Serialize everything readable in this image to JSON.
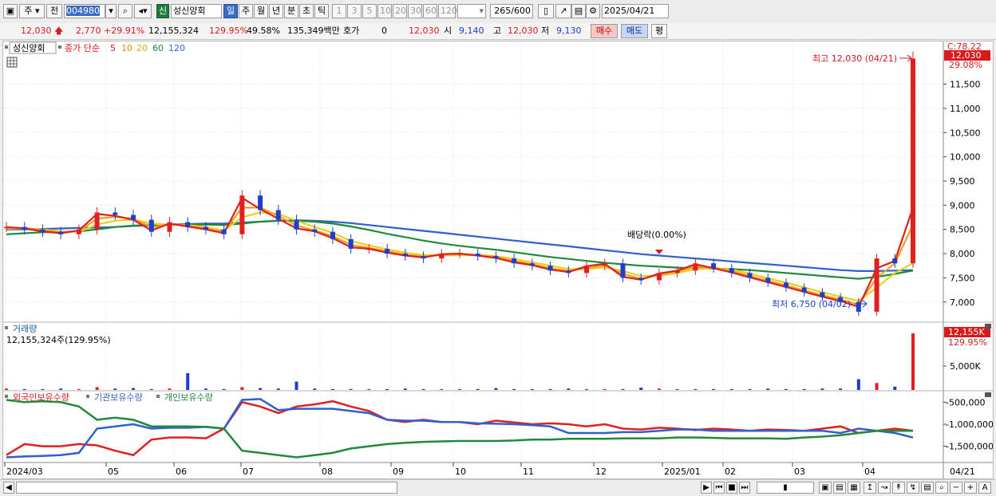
{
  "toolbar": {
    "mode_a": "주",
    "mode_b": "전",
    "code": "004980",
    "shin_badge": "신",
    "stock_name": "성신양회",
    "periods": [
      "일",
      "주",
      "월",
      "년",
      "분",
      "초",
      "틱"
    ],
    "intervals": [
      "1",
      "3",
      "5",
      "10",
      "20",
      "30",
      "60",
      "120"
    ],
    "count": "265",
    "count_max": "/600",
    "date": "2025/04/21"
  },
  "info": {
    "price": "12,030",
    "change": "2,770",
    "change_pct": "+29.91%",
    "volume": "12,155,324",
    "vol_ratio": "129.95%",
    "turnover": "49.58%",
    "amount": "135,349백만",
    "hoga_label": "호가",
    "hoga_value": "0",
    "cur_price": "12,030",
    "open_label": "시",
    "open_value": "9,140",
    "high_label": "고",
    "high_value": "12,030",
    "low_label": "저",
    "low_value": "9,130",
    "buy_label": "매수",
    "sell_label": "매도",
    "avg_label": "평"
  },
  "legend": {
    "name": "성신양회",
    "ma_label": "종가 단순",
    "ma": [
      {
        "label": "5",
        "color": "#e02020"
      },
      {
        "label": "10",
        "color": "#f0a020"
      },
      {
        "label": "20",
        "color": "#e6d020"
      },
      {
        "label": "60",
        "color": "#1e8a3a"
      },
      {
        "label": "120",
        "color": "#2f5fd0"
      }
    ],
    "volume_title": "거래량",
    "volume_value": "12,155,324주(129.95%)",
    "holdings": [
      {
        "label": "외국인보유수량",
        "color": "#e02020"
      },
      {
        "label": "기관보유수량",
        "color": "#2f5fd0"
      },
      {
        "label": "개인보유수량",
        "color": "#1e8a3a"
      }
    ]
  },
  "annotations": {
    "high": "최고 12,030 (04/21)",
    "low": "최저 6,750 (04/02)",
    "dividend": "배당락(0.00%)"
  },
  "right_axis": {
    "top_label": "C:78.22",
    "price_tag": "12,030",
    "price_pct": "29.08%",
    "vol_tag": "12,155K",
    "vol_pct": "129.95%",
    "vol_tick": "5,000K"
  },
  "chart_data": {
    "type": "candlestick",
    "x_labels": [
      "2024/03",
      "05",
      "06",
      "07",
      "08",
      "09",
      "10",
      "11",
      "12",
      "2025/01",
      "02",
      "03",
      "04"
    ],
    "last_x_label": "04/21",
    "price_ticks": [
      7000,
      7500,
      8000,
      8500,
      9000,
      9500,
      10000,
      10500,
      11000,
      11500
    ],
    "price_range": [
      6650,
      12300
    ],
    "price_series": [
      {
        "name": "종가",
        "values": [
          8550,
          8500,
          8450,
          8400,
          8500,
          8850,
          8800,
          8700,
          8450,
          8650,
          8550,
          8500,
          8400,
          9200,
          8900,
          8700,
          8500,
          8450,
          8300,
          8100,
          8100,
          8000,
          7950,
          7900,
          8000,
          8000,
          7950,
          7900,
          7800,
          7750,
          7650,
          7600,
          7750,
          7800,
          7500,
          7450,
          7600,
          7650,
          7800,
          7700,
          7600,
          7500,
          7400,
          7300,
          7200,
          7100,
          7000,
          6800,
          7900,
          7800,
          12030
        ]
      },
      {
        "name": "5",
        "color": "#e02020",
        "values": [
          8550,
          8520,
          8460,
          8420,
          8480,
          8820,
          8780,
          8700,
          8480,
          8620,
          8560,
          8500,
          8420,
          9150,
          8920,
          8720,
          8520,
          8460,
          8320,
          8130,
          8100,
          8020,
          7960,
          7920,
          7990,
          8000,
          7960,
          7910,
          7820,
          7760,
          7670,
          7620,
          7740,
          7790,
          7520,
          7460,
          7590,
          7650,
          7780,
          7700,
          7610,
          7510,
          7410,
          7310,
          7210,
          7110,
          7020,
          6900,
          7700,
          7850,
          8950
        ]
      },
      {
        "name": "10",
        "color": "#f0a020",
        "values": [
          8540,
          8530,
          8480,
          8440,
          8460,
          8720,
          8760,
          8720,
          8550,
          8600,
          8580,
          8520,
          8450,
          8950,
          8950,
          8780,
          8580,
          8480,
          8360,
          8180,
          8120,
          8050,
          7980,
          7940,
          7970,
          7990,
          7970,
          7930,
          7850,
          7780,
          7700,
          7640,
          7700,
          7760,
          7580,
          7480,
          7560,
          7630,
          7730,
          7710,
          7640,
          7540,
          7440,
          7340,
          7240,
          7140,
          7050,
          6950,
          7500,
          7800,
          8600
        ]
      },
      {
        "name": "20",
        "color": "#e6d020",
        "values": [
          8520,
          8520,
          8500,
          8460,
          8450,
          8600,
          8680,
          8700,
          8620,
          8600,
          8590,
          8550,
          8480,
          8750,
          8850,
          8820,
          8680,
          8550,
          8430,
          8260,
          8170,
          8090,
          8020,
          7970,
          7960,
          7970,
          7970,
          7950,
          7890,
          7820,
          7750,
          7680,
          7680,
          7720,
          7640,
          7540,
          7540,
          7600,
          7680,
          7700,
          7670,
          7590,
          7490,
          7400,
          7300,
          7200,
          7110,
          7020,
          7300,
          7600,
          7800
        ]
      },
      {
        "name": "60",
        "color": "#1e8a3a",
        "values": [
          8400,
          8420,
          8440,
          8450,
          8460,
          8500,
          8550,
          8580,
          8590,
          8600,
          8600,
          8600,
          8590,
          8620,
          8660,
          8680,
          8680,
          8660,
          8620,
          8560,
          8490,
          8410,
          8340,
          8270,
          8210,
          8160,
          8120,
          8080,
          8030,
          7980,
          7930,
          7890,
          7850,
          7810,
          7780,
          7750,
          7730,
          7710,
          7700,
          7690,
          7680,
          7660,
          7630,
          7600,
          7570,
          7540,
          7510,
          7480,
          7520,
          7580,
          7650
        ]
      },
      {
        "name": "120",
        "color": "#2f5fd0",
        "values": [
          8500,
          8500,
          8510,
          8520,
          8530,
          8540,
          8550,
          8570,
          8580,
          8600,
          8610,
          8620,
          8620,
          8640,
          8660,
          8680,
          8690,
          8680,
          8660,
          8630,
          8590,
          8550,
          8510,
          8470,
          8430,
          8390,
          8350,
          8310,
          8270,
          8230,
          8190,
          8150,
          8110,
          8070,
          8030,
          7990,
          7960,
          7930,
          7900,
          7870,
          7840,
          7810,
          7780,
          7750,
          7720,
          7690,
          7660,
          7640,
          7640,
          7650,
          7660
        ]
      }
    ],
    "volume_series": {
      "name": "거래량",
      "values": [
        0.3,
        0.2,
        0.2,
        0.3,
        0.2,
        0.6,
        0.3,
        0.4,
        0.2,
        0.3,
        3.6,
        0.3,
        0.2,
        0.6,
        0.4,
        0.3,
        1.8,
        0.3,
        0.2,
        0.2,
        0.2,
        0.2,
        0.3,
        0.2,
        0.2,
        0.2,
        0.2,
        0.4,
        0.2,
        0.2,
        0.2,
        0.3,
        0.2,
        0.2,
        0.2,
        0.5,
        0.3,
        0.2,
        0.2,
        0.2,
        0.2,
        0.2,
        0.3,
        0.2,
        0.2,
        0.3,
        0.3,
        2.3,
        1.5,
        0.7,
        12.155
      ]
    },
    "holding_series": [
      {
        "name": "외국인보유수량",
        "values": [
          -1700000,
          -1450000,
          -1500000,
          -1500000,
          -1450000,
          -1480000,
          -1600000,
          -1700000,
          -1350000,
          -1300000,
          -1300000,
          -1320000,
          -1100000,
          -500000,
          -600000,
          -750000,
          -600000,
          -550000,
          -480000,
          -600000,
          -700000,
          -900000,
          -950000,
          -900000,
          -950000,
          -950000,
          -1000000,
          -920000,
          -960000,
          -1000000,
          -980000,
          -1000000,
          -1050000,
          -1000000,
          -1100000,
          -1120000,
          -1080000,
          -1100000,
          -1130000,
          -1100000,
          -1120000,
          -1150000,
          -1120000,
          -1130000,
          -1150000,
          -1100000,
          -1050000,
          -1200000,
          -1150000,
          -1100000,
          -1150000
        ]
      },
      {
        "name": "기관보유수량",
        "values": [
          -1750000,
          -1730000,
          -1720000,
          -1700000,
          -1650000,
          -1100000,
          -1050000,
          -1000000,
          -1100000,
          -1080000,
          -1080000,
          -1060000,
          -1100000,
          -450000,
          -430000,
          -680000,
          -650000,
          -650000,
          -650000,
          -700000,
          -750000,
          -900000,
          -920000,
          -920000,
          -950000,
          -950000,
          -980000,
          -990000,
          -1000000,
          -1020000,
          -1050000,
          -1200000,
          -1200000,
          -1200000,
          -1180000,
          -1180000,
          -1150000,
          -1120000,
          -1120000,
          -1150000,
          -1150000,
          -1150000,
          -1150000,
          -1150000,
          -1150000,
          -1150000,
          -1200000,
          -1100000,
          -1150000,
          -1200000,
          -1300000
        ]
      },
      {
        "name": "개인보유수량",
        "values": [
          -450000,
          -500000,
          -480000,
          -500000,
          -600000,
          -900000,
          -850000,
          -900000,
          -1050000,
          -1050000,
          -1050000,
          -1060000,
          -1100000,
          -1600000,
          -1650000,
          -1700000,
          -1750000,
          -1700000,
          -1650000,
          -1550000,
          -1500000,
          -1450000,
          -1420000,
          -1400000,
          -1390000,
          -1380000,
          -1380000,
          -1380000,
          -1370000,
          -1350000,
          -1350000,
          -1330000,
          -1330000,
          -1330000,
          -1320000,
          -1320000,
          -1320000,
          -1300000,
          -1300000,
          -1310000,
          -1320000,
          -1320000,
          -1320000,
          -1330000,
          -1300000,
          -1280000,
          -1250000,
          -1200000,
          -1150000,
          -1150000,
          -1150000
        ]
      }
    ],
    "holding_ticks": [
      -500000,
      -1000000,
      -1500000
    ],
    "holding_range": [
      -1850000,
      -350000
    ]
  }
}
